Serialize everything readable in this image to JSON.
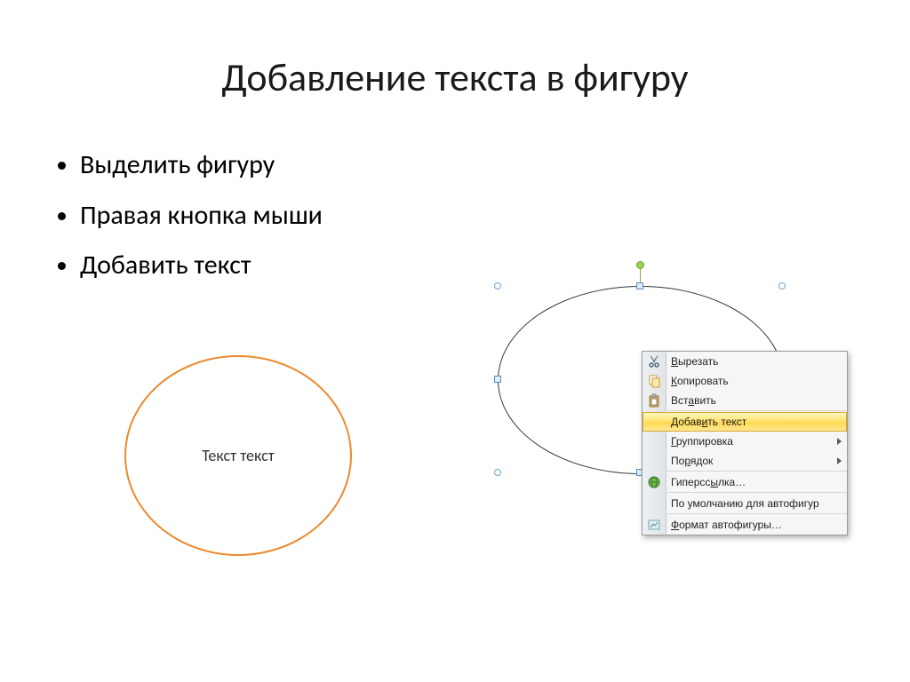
{
  "title": "Добавление текста в фигуру",
  "bullets": [
    "Выделить фигуру",
    "Правая кнопка мыши",
    "Добавить текст"
  ],
  "orange_shape_text": "Текст текст",
  "context_menu": {
    "cut": "Вырезать",
    "copy": "Копировать",
    "paste": "Вставить",
    "add_text": "Добавить текст",
    "group": "Группировка",
    "order": "Порядок",
    "hyperlink": "Гиперссылка…",
    "defaults": "По умолчанию для автофигур",
    "format": "Формат автофигуры…"
  },
  "icons": {
    "cut": "cut-icon",
    "copy": "copy-icon",
    "paste": "paste-icon",
    "link": "globe-link-icon",
    "format": "format-shape-icon"
  },
  "colors": {
    "orange": "#ec8a2d",
    "highlight_top": "#fff7c2",
    "highlight_bottom": "#ffe794",
    "selection_handle": "#6aa3cf",
    "rotation_handle": "#9bd24b"
  }
}
